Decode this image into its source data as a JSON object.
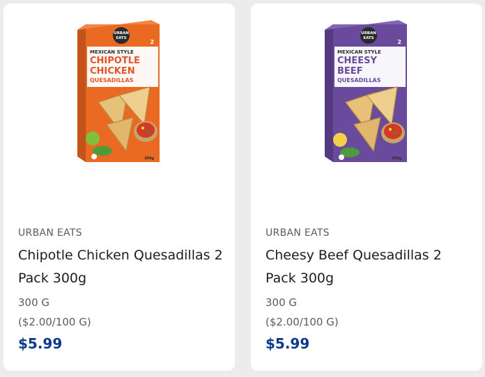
{
  "colors": {
    "page_background": "#ececec",
    "card_background": "#ffffff",
    "price": "#0d3a8c",
    "muted_text": "#5c5c5c",
    "title_text": "#1d1d1d"
  },
  "products": [
    {
      "brand": "URBAN EATS",
      "title": "Chipotle Chicken Quesadillas 2 Pack 300g",
      "size": "300 G",
      "unit_price": "($2.00/100 G)",
      "price": "$5.99",
      "image": {
        "box_color": "#ea6a24",
        "box_logo": [
          "URBAN",
          "EATS"
        ],
        "box_style": "MEXICAN STYLE",
        "box_name": [
          "CHIPOTLE",
          "CHICKEN"
        ],
        "box_sub": "QUESADILLAS",
        "box_count": "2",
        "box_weight": "300g"
      }
    },
    {
      "brand": "URBAN EATS",
      "title": "Cheesy Beef Quesadillas 2 Pack 300g",
      "size": "300 G",
      "unit_price": "($2.00/100 G)",
      "price": "$5.99",
      "image": {
        "box_color": "#6a4a9c",
        "box_logo": [
          "URBAN",
          "EATS"
        ],
        "box_style": "MEXICAN STYLE",
        "box_name": [
          "CHEESY",
          "BEEF"
        ],
        "box_sub": "QUESADILLAS",
        "box_count": "2",
        "box_weight": "300g"
      }
    }
  ]
}
